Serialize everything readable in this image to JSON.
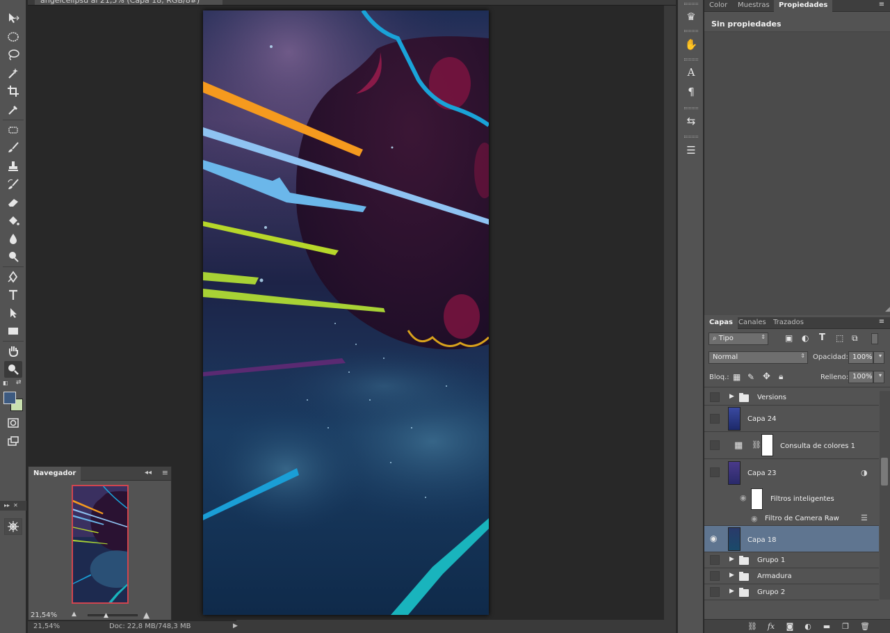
{
  "document": {
    "tab_title": "ángelcelipsu al 21,5% (Capa 18, RGB/8#)"
  },
  "toolbar": {
    "tools": [
      {
        "name": "move-tool",
        "icon": "move-arrow-icon"
      },
      {
        "name": "marquee-tool",
        "icon": "ellipse-marquee-icon"
      },
      {
        "name": "lasso-tool",
        "icon": "lasso-icon"
      },
      {
        "name": "magic-wand-tool",
        "icon": "magic-wand-icon"
      },
      {
        "name": "crop-tool",
        "icon": "crop-icon"
      },
      {
        "name": "eyedropper-tool",
        "icon": "eyedropper-icon"
      },
      {
        "name": "healing-brush-tool",
        "icon": "healing-brush-icon"
      },
      {
        "name": "brush-tool",
        "icon": "brush-icon"
      },
      {
        "name": "clone-stamp-tool",
        "icon": "stamp-icon"
      },
      {
        "name": "history-brush-tool",
        "icon": "history-brush-icon"
      },
      {
        "name": "eraser-tool",
        "icon": "eraser-icon"
      },
      {
        "name": "paint-bucket-tool",
        "icon": "paint-bucket-icon"
      },
      {
        "name": "blur-tool",
        "icon": "drop-icon"
      },
      {
        "name": "dodge-tool",
        "icon": "dodge-icon"
      },
      {
        "name": "pen-tool",
        "icon": "pen-icon"
      },
      {
        "name": "type-tool",
        "icon": "type-icon"
      },
      {
        "name": "path-selection-tool",
        "icon": "arrow-select-icon"
      },
      {
        "name": "rectangle-tool",
        "icon": "rectangle-icon"
      },
      {
        "name": "hand-tool",
        "icon": "hand-icon"
      },
      {
        "name": "zoom-tool",
        "icon": "zoom-icon"
      }
    ],
    "foreground_color": "#3d5a80",
    "background_color": "#c9e0b0"
  },
  "navigator": {
    "title": "Navegador",
    "zoom": "21,54%"
  },
  "status": {
    "zoom": "21,54%",
    "doc_info": "Doc: 22,8 MB/748,3 MB"
  },
  "properties_panel": {
    "tabs": [
      {
        "label": "Color",
        "active": false
      },
      {
        "label": "Muestras",
        "active": false
      },
      {
        "label": "Propiedades",
        "active": true
      }
    ],
    "empty_label": "Sin propiedades"
  },
  "layers_panel": {
    "tabs": [
      {
        "label": "Capas",
        "active": true
      },
      {
        "label": "Canales",
        "active": false
      },
      {
        "label": "Trazados",
        "active": false
      }
    ],
    "filter_kind": "Tipo",
    "blend_mode": "Normal",
    "opacity_label": "Opacidad:",
    "opacity_value": "100%",
    "lock_label": "Bloq.:",
    "fill_label": "Relleno:",
    "fill_value": "100%",
    "layers": [
      {
        "name": "Versions",
        "type": "group",
        "visible": false
      },
      {
        "name": "Capa 24",
        "type": "pixel",
        "visible": false
      },
      {
        "name": "Consulta de colores 1",
        "type": "adjustment",
        "visible": false
      },
      {
        "name": "Capa 23",
        "type": "smart",
        "visible": false
      },
      {
        "name": "Filtros inteligentes",
        "type": "smart-filter-header"
      },
      {
        "name": "Filtro de Camera Raw",
        "type": "smart-filter"
      },
      {
        "name": "Capa 18",
        "type": "pixel",
        "visible": true,
        "selected": true
      },
      {
        "name": "Grupo 1",
        "type": "group",
        "visible": false
      },
      {
        "name": "Armadura",
        "type": "group",
        "visible": false
      },
      {
        "name": "Grupo 2",
        "type": "group",
        "visible": false
      }
    ]
  },
  "colors": {
    "panel_bg": "#535353",
    "selected_layer": "#5f7590",
    "nav_frame": "#d0454f"
  }
}
